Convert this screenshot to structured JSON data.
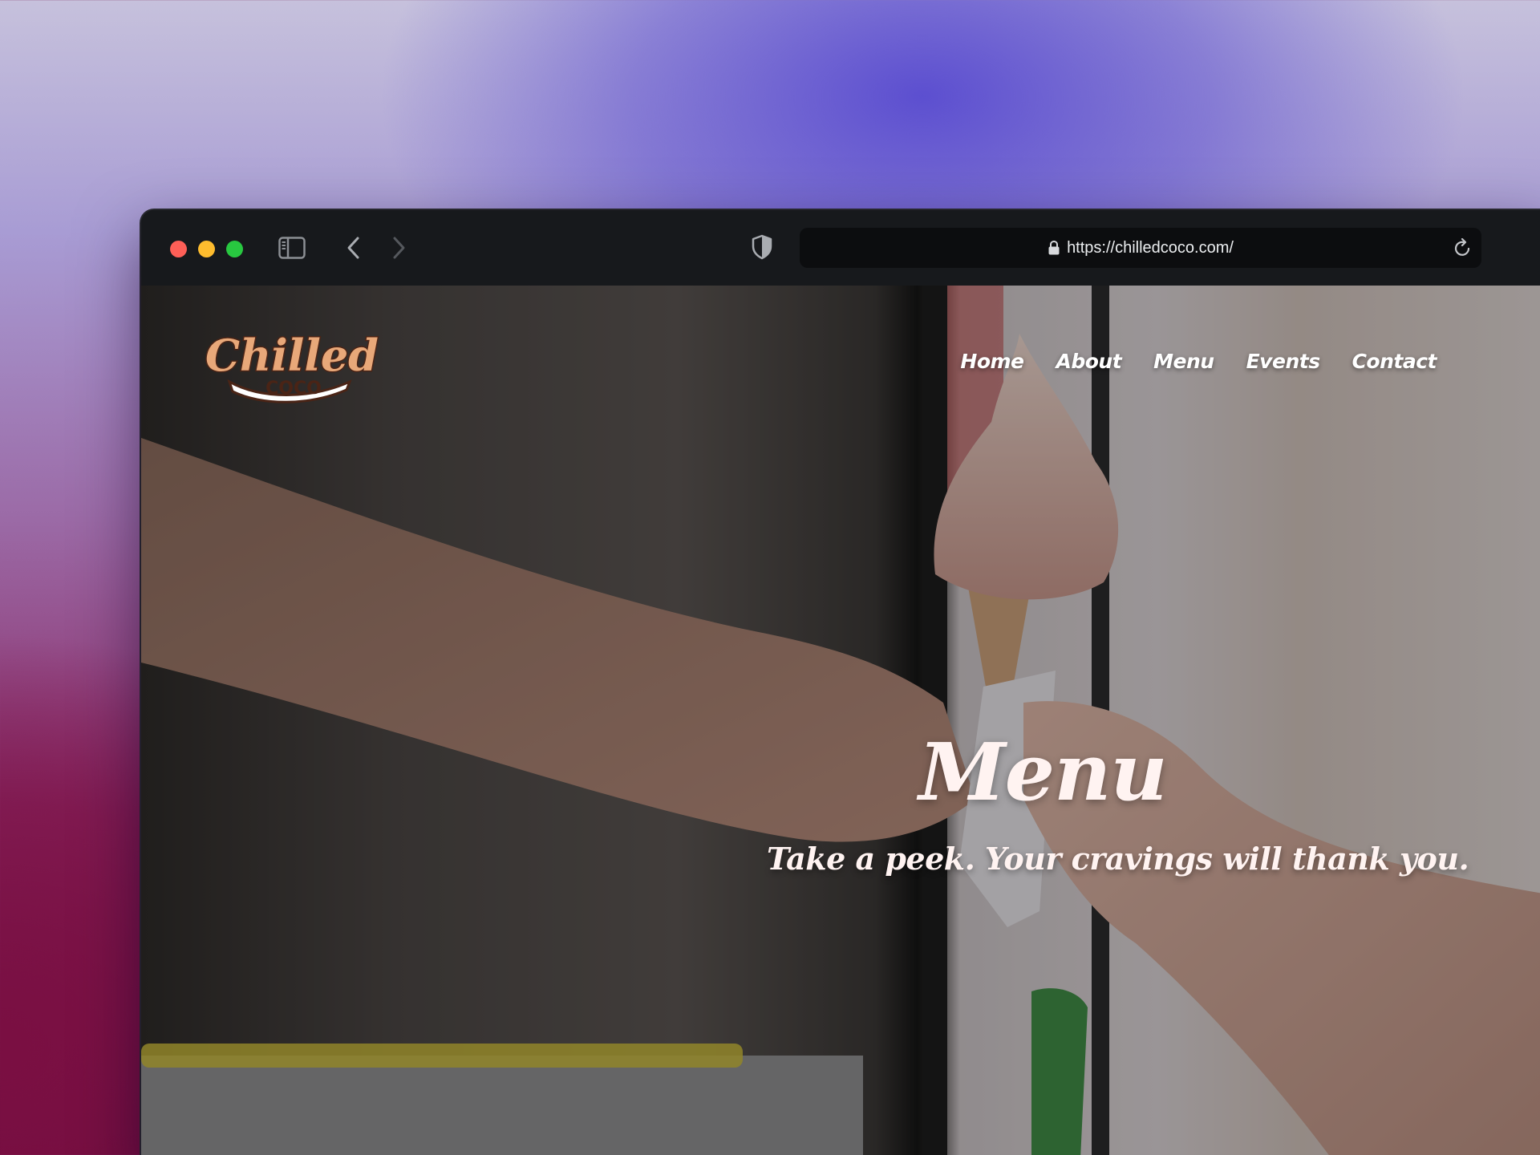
{
  "browser": {
    "url": "https://chilledcoco.com/",
    "traffic_lights": {
      "close": "#fe5f57",
      "minimize": "#febc2e",
      "zoom": "#28c840"
    },
    "icons": [
      "sidebar-toggle-icon",
      "back-chevron-icon",
      "forward-chevron-icon",
      "privacy-shield-icon",
      "lock-icon",
      "reload-icon"
    ]
  },
  "site": {
    "logo": {
      "top": "Chilled",
      "bottom": "COCO"
    },
    "nav": [
      {
        "label": "Home"
      },
      {
        "label": "About"
      },
      {
        "label": "Menu"
      },
      {
        "label": "Events"
      },
      {
        "label": "Contact"
      }
    ],
    "hero": {
      "title": "Menu",
      "subtitle": "Take a peek. Your cravings will thank you."
    }
  },
  "colors": {
    "text_light": "#fff3f1",
    "logo_brown": "#4a2416",
    "logo_gold": "#e8a879"
  }
}
